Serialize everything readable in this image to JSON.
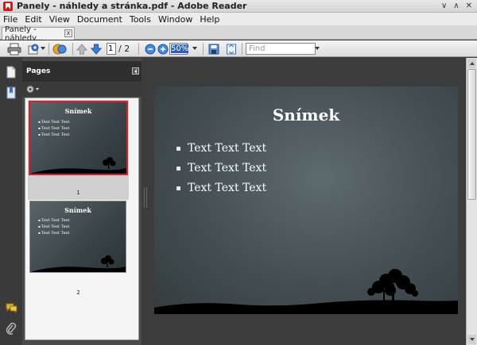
{
  "window": {
    "title": "Panely - náhledy a stránka.pdf - Adobe Reader",
    "controls": [
      "∨",
      "∧",
      "✕"
    ]
  },
  "menu": [
    "File",
    "Edit",
    "View",
    "Document",
    "Tools",
    "Window",
    "Help"
  ],
  "tab": {
    "label": "Panely - náhledy...",
    "close": "x"
  },
  "toolbar": {
    "current_page": "1",
    "page_total": "/  2",
    "zoom": "50%",
    "find_placeholder": "Find"
  },
  "panel": {
    "title": "Pages"
  },
  "thumbnails": [
    {
      "page": "1",
      "title": "Snímek",
      "bullets": [
        "Text Text Text",
        "Text Text Text",
        "Text Text Text"
      ],
      "selected": true
    },
    {
      "page": "2",
      "title": "Snímek",
      "bullets": [
        "Text Text Text",
        "Text Text Text",
        "Text Text Text"
      ],
      "selected": false
    }
  ],
  "slide": {
    "title": "Snímek",
    "bullets": [
      "Text Text Text",
      "Text Text Text",
      "Text Text Text"
    ]
  },
  "colors": {
    "selection_border": "#d6202c",
    "slide_bg": "#454f53",
    "app_red": "#c81e1e"
  },
  "icons": {
    "print": "printer-icon",
    "share": "share-icon",
    "collaborate": "collaborate-icon",
    "prev": "arrow-up-icon",
    "next": "arrow-down-icon",
    "zoom_out": "zoom-out-icon",
    "zoom_in": "zoom-in-icon",
    "save": "save-icon",
    "fit": "fit-page-icon"
  }
}
